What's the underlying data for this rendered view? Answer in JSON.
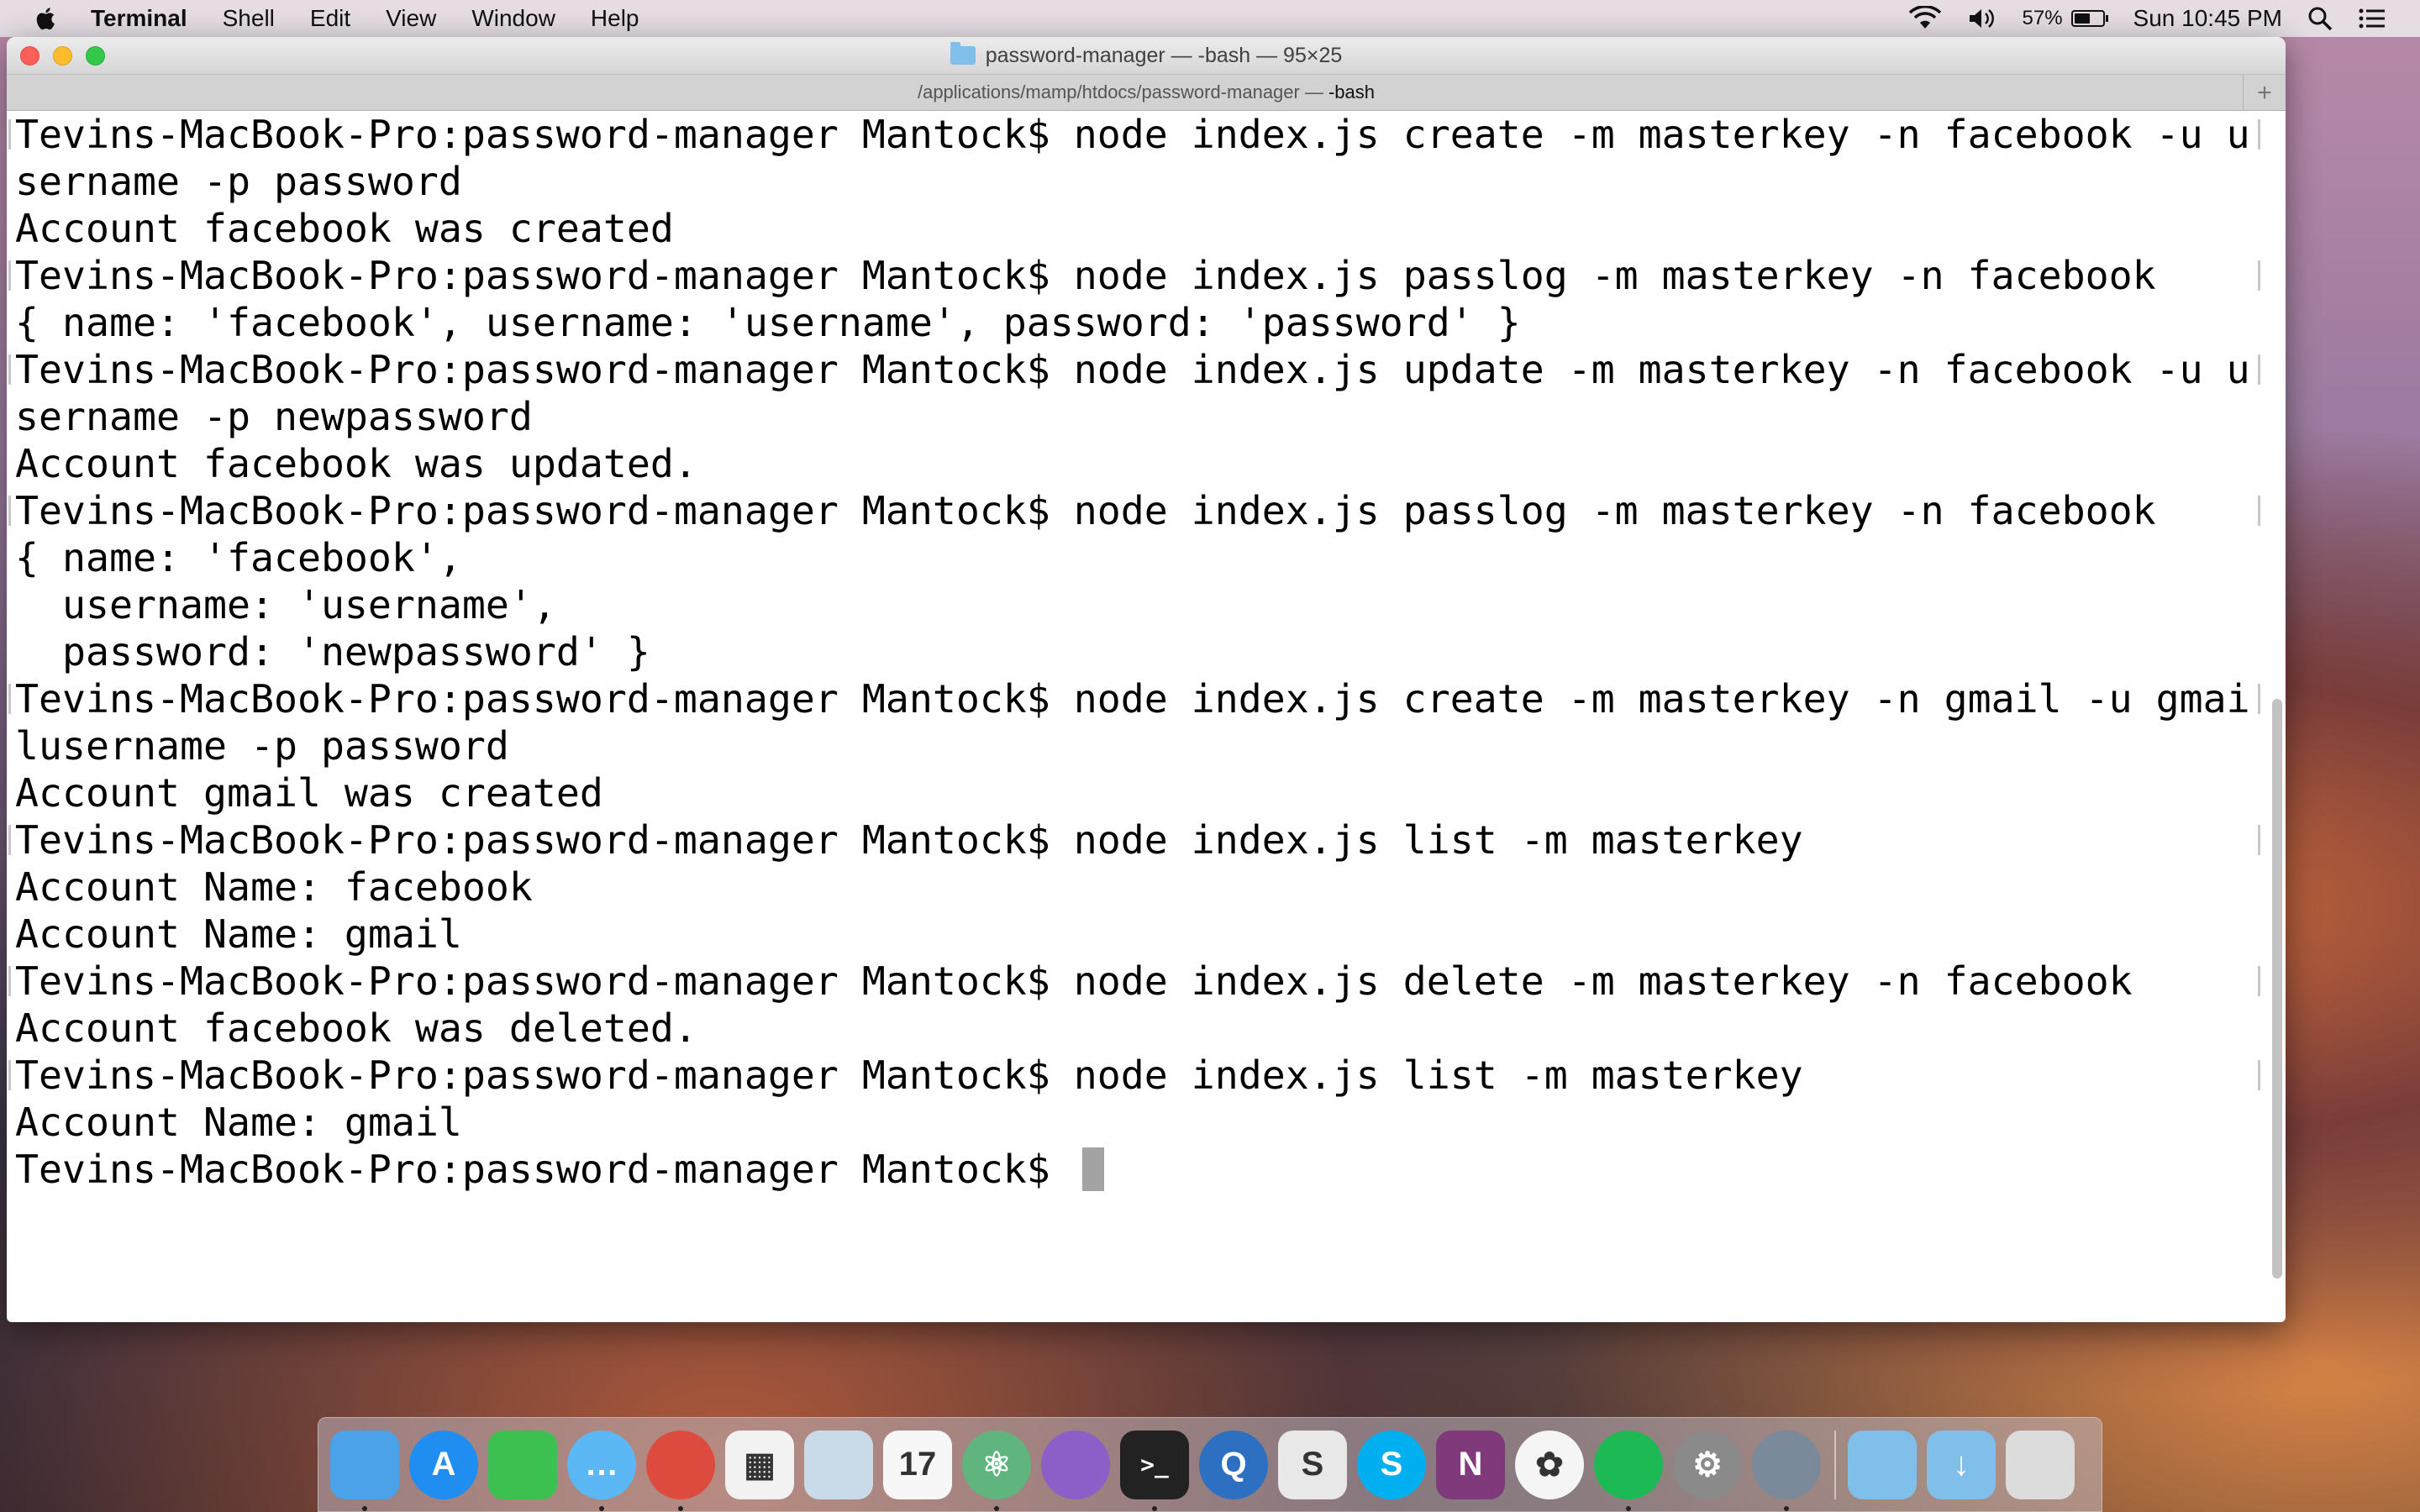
{
  "menubar": {
    "app": "Terminal",
    "items": [
      "Shell",
      "Edit",
      "View",
      "Window",
      "Help"
    ],
    "battery": "57%",
    "battery_level": 0.57,
    "clock": "Sun 10:45 PM"
  },
  "window": {
    "title": "password-manager — -bash — 95×25",
    "tab_path": "/applications/mamp/htdocs/password-manager —",
    "tab_cmd": "-bash",
    "new_tab": "+"
  },
  "terminal": {
    "lines": [
      "Tevins-MacBook-Pro:password-manager Mantock$ node index.js create -m masterkey -n facebook -u u",
      "sername -p password",
      "Account facebook was created",
      "Tevins-MacBook-Pro:password-manager Mantock$ node index.js passlog -m masterkey -n facebook",
      "{ name: 'facebook', username: 'username', password: 'password' }",
      "Tevins-MacBook-Pro:password-manager Mantock$ node index.js update -m masterkey -n facebook -u u",
      "sername -p newpassword",
      "Account facebook was updated.",
      "Tevins-MacBook-Pro:password-manager Mantock$ node index.js passlog -m masterkey -n facebook",
      "{ name: 'facebook',",
      "  username: 'username',",
      "  password: 'newpassword' }",
      "Tevins-MacBook-Pro:password-manager Mantock$ node index.js create -m masterkey -n gmail -u gmai",
      "lusername -p password",
      "Account gmail was created",
      "Tevins-MacBook-Pro:password-manager Mantock$ node index.js list -m masterkey",
      "Account Name: facebook",
      "Account Name: gmail",
      "Tevins-MacBook-Pro:password-manager Mantock$ node index.js delete -m masterkey -n facebook",
      "Account facebook was deleted.",
      "Tevins-MacBook-Pro:password-manager Mantock$ node index.js list -m masterkey",
      "Account Name: gmail",
      "Tevins-MacBook-Pro:password-manager Mantock$ "
    ]
  },
  "dock": {
    "apps": [
      {
        "name": "finder-icon",
        "glyph": "",
        "color": "#4aa3e8",
        "running": true
      },
      {
        "name": "app-store-icon",
        "glyph": "A",
        "color": "#1f8ef0",
        "running": false,
        "round": true
      },
      {
        "name": "facetime-icon",
        "glyph": "",
        "color": "#3cc04f",
        "running": false
      },
      {
        "name": "messages-icon",
        "glyph": "…",
        "color": "#5cb8f5",
        "running": true,
        "round": true
      },
      {
        "name": "chrome-icon",
        "glyph": "",
        "color": "#dd4b3e",
        "running": true,
        "round": true
      },
      {
        "name": "launchpad-icon",
        "glyph": "▦",
        "color": "#f2f2f2",
        "running": false
      },
      {
        "name": "preview-icon",
        "glyph": "",
        "color": "#c9dbe8",
        "running": false
      },
      {
        "name": "calendar-icon",
        "glyph": "17",
        "color": "#f7f7f7",
        "running": false
      },
      {
        "name": "atom-icon",
        "glyph": "⚛",
        "color": "#5fb57d",
        "running": true,
        "round": true
      },
      {
        "name": "github-desktop-icon",
        "glyph": "",
        "color": "#8b5fc7",
        "running": false,
        "round": true
      },
      {
        "name": "terminal-icon",
        "glyph": ">_",
        "color": "#222222",
        "running": true
      },
      {
        "name": "quicktime-icon",
        "glyph": "Q",
        "color": "#2d6fc0",
        "running": false,
        "round": true
      },
      {
        "name": "slides-icon",
        "glyph": "S",
        "color": "#e8e8e8",
        "running": false
      },
      {
        "name": "skype-icon",
        "glyph": "S",
        "color": "#00aff0",
        "running": false,
        "round": true
      },
      {
        "name": "onenote-icon",
        "glyph": "N",
        "color": "#80397b",
        "running": false
      },
      {
        "name": "photos-icon",
        "glyph": "✿",
        "color": "#f5f5f5",
        "running": false,
        "round": true
      },
      {
        "name": "spotify-icon",
        "glyph": "",
        "color": "#1db954",
        "running": true,
        "round": true
      },
      {
        "name": "system-preferences-icon",
        "glyph": "⚙",
        "color": "#8a8a8a",
        "running": false,
        "round": true
      },
      {
        "name": "sequel-pro-icon",
        "glyph": "",
        "color": "#7a8a9a",
        "running": true,
        "round": true
      }
    ],
    "stack_apps": [
      {
        "name": "documents-folder-icon",
        "glyph": "",
        "color": "#7fbfea"
      },
      {
        "name": "downloads-folder-icon",
        "glyph": "↓",
        "color": "#7fbfea"
      },
      {
        "name": "trash-icon",
        "glyph": "",
        "color": "#dcdcdc"
      }
    ]
  }
}
